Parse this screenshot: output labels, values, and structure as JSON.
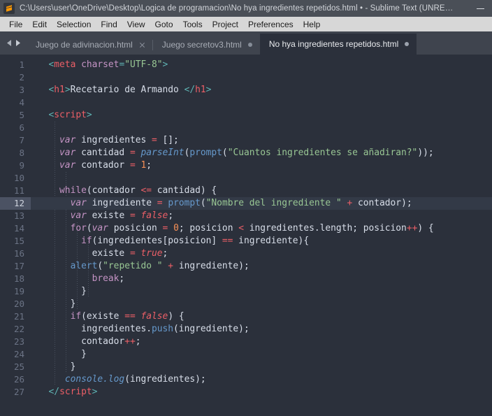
{
  "window": {
    "title": "C:\\Users\\user\\OneDrive\\Desktop\\Logica de programacion\\No hya ingredientes repetidos.html • - Sublime Text (UNRE…",
    "logo_icon": "sublime-text-logo-icon",
    "minimize_label": "Minimize",
    "accent_color": "#ff9800",
    "titlebar_color": "#4a4f57"
  },
  "menubar": {
    "items": [
      {
        "label": "File"
      },
      {
        "label": "Edit"
      },
      {
        "label": "Selection"
      },
      {
        "label": "Find"
      },
      {
        "label": "View"
      },
      {
        "label": "Goto"
      },
      {
        "label": "Tools"
      },
      {
        "label": "Project"
      },
      {
        "label": "Preferences"
      },
      {
        "label": "Help"
      }
    ]
  },
  "tabbar": {
    "prev_arrow_icon": "chevron-left-icon",
    "next_arrow_icon": "chevron-right-icon",
    "tabs": [
      {
        "label": "Juego de adivinacion.html",
        "active": false,
        "indicator": "close-icon"
      },
      {
        "label": "Juego secretov3.html",
        "active": false,
        "indicator": "unsaved-dot"
      },
      {
        "label": "No hya ingredientes repetidos.html",
        "active": true,
        "indicator": "unsaved-dot"
      }
    ]
  },
  "editor": {
    "active_line": 12,
    "background_color": "#2b303b",
    "gutter_color": "#2b303b",
    "line_numbers": [
      1,
      2,
      3,
      4,
      5,
      6,
      7,
      8,
      9,
      10,
      11,
      12,
      13,
      14,
      15,
      16,
      17,
      18,
      19,
      20,
      21,
      22,
      23,
      24,
      25,
      26,
      27
    ],
    "lines": [
      {
        "n": 1,
        "tokens": [
          {
            "t": "  ",
            "c": "plain"
          },
          {
            "t": "<",
            "c": "punct"
          },
          {
            "t": "meta",
            "c": "tag"
          },
          {
            "t": " ",
            "c": "plain"
          },
          {
            "t": "charset",
            "c": "attr"
          },
          {
            "t": "=",
            "c": "punct"
          },
          {
            "t": "\"UTF-8\"",
            "c": "string"
          },
          {
            "t": ">",
            "c": "punct"
          }
        ]
      },
      {
        "n": 2,
        "tokens": []
      },
      {
        "n": 3,
        "tokens": [
          {
            "t": "  ",
            "c": "plain"
          },
          {
            "t": "<",
            "c": "punct"
          },
          {
            "t": "h1",
            "c": "tag"
          },
          {
            "t": ">",
            "c": "punct"
          },
          {
            "t": "Recetario de Armando ",
            "c": "plain"
          },
          {
            "t": "</",
            "c": "punct"
          },
          {
            "t": "h1",
            "c": "tag"
          },
          {
            "t": ">",
            "c": "punct"
          }
        ]
      },
      {
        "n": 4,
        "tokens": []
      },
      {
        "n": 5,
        "tokens": [
          {
            "t": "  ",
            "c": "plain"
          },
          {
            "t": "<",
            "c": "punct"
          },
          {
            "t": "script",
            "c": "tag"
          },
          {
            "t": ">",
            "c": "punct"
          }
        ]
      },
      {
        "n": 6,
        "tokens": []
      },
      {
        "n": 7,
        "tokens": [
          {
            "t": "    ",
            "c": "plain"
          },
          {
            "t": "var",
            "c": "kw"
          },
          {
            "t": " ingredientes ",
            "c": "plain"
          },
          {
            "t": "=",
            "c": "op"
          },
          {
            "t": " [];",
            "c": "plain"
          }
        ]
      },
      {
        "n": 8,
        "tokens": [
          {
            "t": "    ",
            "c": "plain"
          },
          {
            "t": "var",
            "c": "kw"
          },
          {
            "t": " cantidad ",
            "c": "plain"
          },
          {
            "t": "=",
            "c": "op"
          },
          {
            "t": " ",
            "c": "plain"
          },
          {
            "t": "parseInt",
            "c": "fn"
          },
          {
            "t": "(",
            "c": "plain"
          },
          {
            "t": "prompt",
            "c": "fnp"
          },
          {
            "t": "(",
            "c": "plain"
          },
          {
            "t": "\"Cuantos ingredientes se añadiran?\"",
            "c": "string"
          },
          {
            "t": "));",
            "c": "plain"
          }
        ]
      },
      {
        "n": 9,
        "tokens": [
          {
            "t": "    ",
            "c": "plain"
          },
          {
            "t": "var",
            "c": "kw"
          },
          {
            "t": " contador ",
            "c": "plain"
          },
          {
            "t": "=",
            "c": "op"
          },
          {
            "t": " ",
            "c": "plain"
          },
          {
            "t": "1",
            "c": "num"
          },
          {
            "t": ";",
            "c": "plain"
          }
        ]
      },
      {
        "n": 10,
        "tokens": []
      },
      {
        "n": 11,
        "tokens": [
          {
            "t": "    ",
            "c": "plain"
          },
          {
            "t": "while",
            "c": "kwp"
          },
          {
            "t": "(contador ",
            "c": "plain"
          },
          {
            "t": "<=",
            "c": "op"
          },
          {
            "t": " cantidad) {",
            "c": "plain"
          }
        ]
      },
      {
        "n": 12,
        "tokens": [
          {
            "t": "      ",
            "c": "plain"
          },
          {
            "t": "var",
            "c": "kw"
          },
          {
            "t": " ingrediente ",
            "c": "plain"
          },
          {
            "t": "=",
            "c": "op"
          },
          {
            "t": " ",
            "c": "plain"
          },
          {
            "t": "prompt",
            "c": "fnp"
          },
          {
            "t": "(",
            "c": "plain"
          },
          {
            "t": "\"Nombre del ingrediente \"",
            "c": "string"
          },
          {
            "t": " ",
            "c": "plain"
          },
          {
            "t": "+",
            "c": "op"
          },
          {
            "t": " contador);",
            "c": "plain"
          }
        ]
      },
      {
        "n": 13,
        "tokens": [
          {
            "t": "      ",
            "c": "plain"
          },
          {
            "t": "var",
            "c": "kw"
          },
          {
            "t": " existe ",
            "c": "plain"
          },
          {
            "t": "=",
            "c": "op"
          },
          {
            "t": " ",
            "c": "plain"
          },
          {
            "t": "false",
            "c": "const"
          },
          {
            "t": ";",
            "c": "plain"
          }
        ]
      },
      {
        "n": 14,
        "tokens": [
          {
            "t": "      ",
            "c": "plain"
          },
          {
            "t": "for",
            "c": "kwp"
          },
          {
            "t": "(",
            "c": "plain"
          },
          {
            "t": "var",
            "c": "kw"
          },
          {
            "t": " posicion ",
            "c": "plain"
          },
          {
            "t": "=",
            "c": "op"
          },
          {
            "t": " ",
            "c": "plain"
          },
          {
            "t": "0",
            "c": "num"
          },
          {
            "t": "; posicion ",
            "c": "plain"
          },
          {
            "t": "<",
            "c": "op"
          },
          {
            "t": " ingredientes.length; posicion",
            "c": "plain"
          },
          {
            "t": "++",
            "c": "op"
          },
          {
            "t": ") {",
            "c": "plain"
          }
        ]
      },
      {
        "n": 15,
        "tokens": [
          {
            "t": "        ",
            "c": "plain"
          },
          {
            "t": "if",
            "c": "kwp"
          },
          {
            "t": "(ingredientes[posicion] ",
            "c": "plain"
          },
          {
            "t": "==",
            "c": "op"
          },
          {
            "t": " ingrediente){",
            "c": "plain"
          }
        ]
      },
      {
        "n": 16,
        "tokens": [
          {
            "t": "          ",
            "c": "plain"
          },
          {
            "t": "existe ",
            "c": "plain"
          },
          {
            "t": "=",
            "c": "op"
          },
          {
            "t": " ",
            "c": "plain"
          },
          {
            "t": "true",
            "c": "const"
          },
          {
            "t": ";",
            "c": "plain"
          }
        ]
      },
      {
        "n": 17,
        "tokens": [
          {
            "t": "      ",
            "c": "plain"
          },
          {
            "t": "alert",
            "c": "fnp"
          },
          {
            "t": "(",
            "c": "plain"
          },
          {
            "t": "\"repetido \"",
            "c": "string"
          },
          {
            "t": " ",
            "c": "plain"
          },
          {
            "t": "+",
            "c": "op"
          },
          {
            "t": " ingrediente);",
            "c": "plain"
          }
        ]
      },
      {
        "n": 18,
        "tokens": [
          {
            "t": "          ",
            "c": "plain"
          },
          {
            "t": "break",
            "c": "kwp"
          },
          {
            "t": ";",
            "c": "plain"
          }
        ]
      },
      {
        "n": 19,
        "tokens": [
          {
            "t": "        }",
            "c": "plain"
          }
        ]
      },
      {
        "n": 20,
        "tokens": [
          {
            "t": "      }",
            "c": "plain"
          }
        ]
      },
      {
        "n": 21,
        "tokens": [
          {
            "t": "      ",
            "c": "plain"
          },
          {
            "t": "if",
            "c": "kwp"
          },
          {
            "t": "(existe ",
            "c": "plain"
          },
          {
            "t": "==",
            "c": "op"
          },
          {
            "t": " ",
            "c": "plain"
          },
          {
            "t": "false",
            "c": "const"
          },
          {
            "t": ") {",
            "c": "plain"
          }
        ]
      },
      {
        "n": 22,
        "tokens": [
          {
            "t": "        ",
            "c": "plain"
          },
          {
            "t": "ingredientes.",
            "c": "plain"
          },
          {
            "t": "push",
            "c": "fnp"
          },
          {
            "t": "(ingrediente);",
            "c": "plain"
          }
        ]
      },
      {
        "n": 23,
        "tokens": [
          {
            "t": "        ",
            "c": "plain"
          },
          {
            "t": "contador",
            "c": "plain"
          },
          {
            "t": "++",
            "c": "op"
          },
          {
            "t": ";",
            "c": "plain"
          }
        ]
      },
      {
        "n": 24,
        "tokens": [
          {
            "t": "        }",
            "c": "plain"
          }
        ]
      },
      {
        "n": 25,
        "tokens": [
          {
            "t": "      }",
            "c": "plain"
          }
        ]
      },
      {
        "n": 26,
        "tokens": [
          {
            "t": "     ",
            "c": "plain"
          },
          {
            "t": "console",
            "c": "fn"
          },
          {
            "t": ".",
            "c": "fn"
          },
          {
            "t": "log",
            "c": "fn"
          },
          {
            "t": "(ingredientes);",
            "c": "plain"
          }
        ]
      },
      {
        "n": 27,
        "tokens": [
          {
            "t": "  ",
            "c": "plain"
          },
          {
            "t": "</",
            "c": "punct"
          },
          {
            "t": "script",
            "c": "tag"
          },
          {
            "t": ">",
            "c": "punct"
          }
        ]
      }
    ],
    "indent_guides": [
      {
        "x": 24,
        "from": 6,
        "to": 26
      },
      {
        "x": 40,
        "from": 10,
        "to": 25
      },
      {
        "x": 56,
        "from": 14,
        "to": 20
      },
      {
        "x": 72,
        "from": 15,
        "to": 19
      }
    ]
  }
}
